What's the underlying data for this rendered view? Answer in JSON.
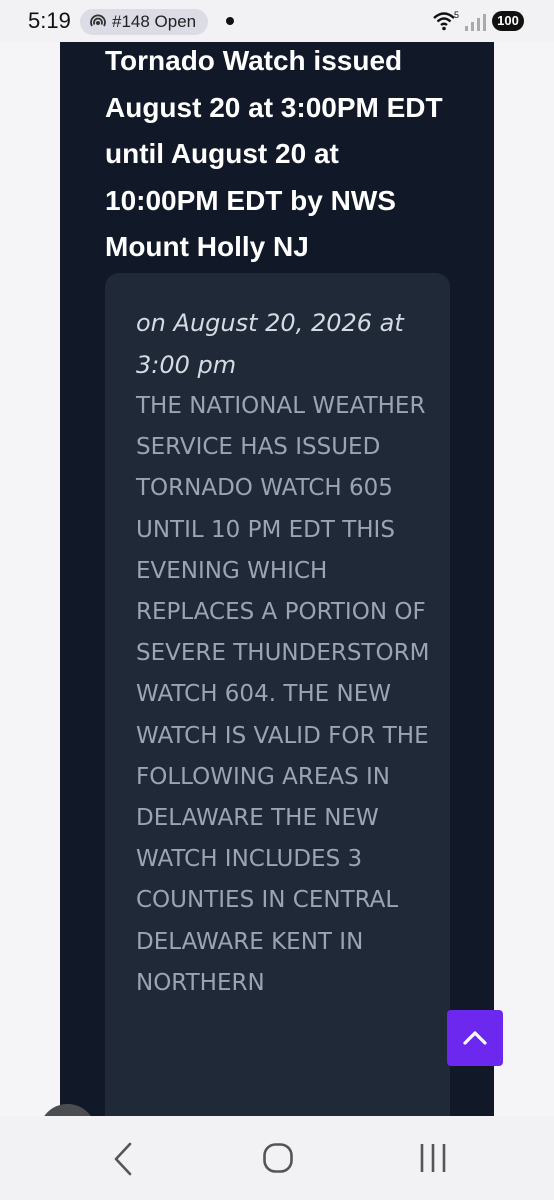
{
  "status_bar": {
    "time": "5:19",
    "notification_pill": "#148 Open",
    "battery": "100",
    "icons": [
      "podcast-icon",
      "dot-icon",
      "wifi-icon",
      "signal-icon",
      "battery-icon"
    ]
  },
  "alert": {
    "title": "Tornado Watch issued August 20 at 3:00PM EDT until August 20 at 10:00PM EDT by NWS Mount Holly NJ",
    "date_line": "on August 20, 2026 at 3:00 pm",
    "body": "THE NATIONAL WEATHER SERVICE HAS ISSUED TORNADO WATCH 605 UNTIL 10 PM EDT THIS EVENING WHICH REPLACES A PORTION OF SEVERE THUNDERSTORM WATCH 604. THE NEW WATCH IS VALID FOR THE FOLLOWING AREAS IN DELAWARE THE NEW WATCH INCLUDES 3 COUNTIES IN CENTRAL DELAWARE KENT IN NORTHERN"
  },
  "controls": {
    "scroll_top_icon": "chevron-up-icon",
    "floating_icon": "phone-icon"
  },
  "nav_bar": {
    "icons": [
      "back-icon",
      "home-icon",
      "recent-apps-icon"
    ]
  },
  "colors": {
    "article_bg": "#111827",
    "card_bg": "#1f2937",
    "accent": "#6d28f0",
    "body_text": "#9aa4b4"
  }
}
